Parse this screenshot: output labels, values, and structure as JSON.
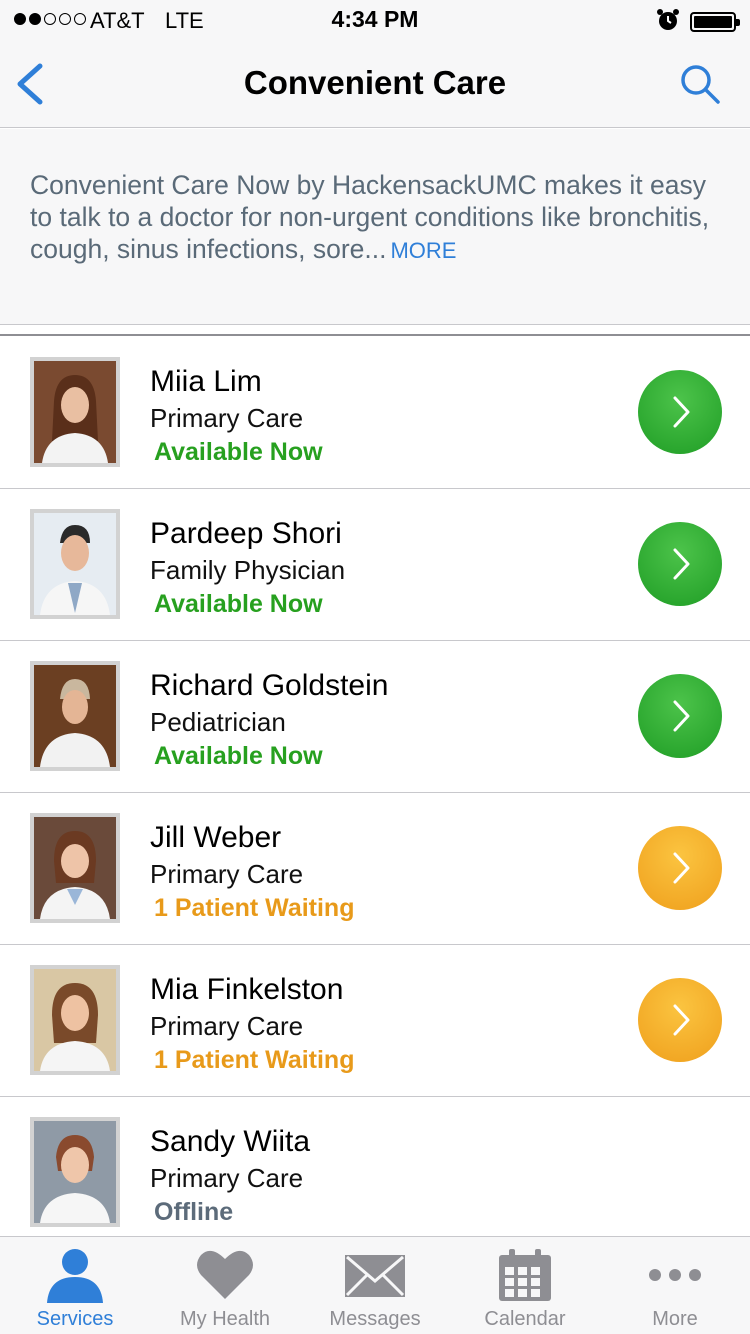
{
  "status_bar": {
    "carrier": "AT&T",
    "network": "LTE",
    "time": "4:34 PM"
  },
  "nav": {
    "title": "Convenient Care"
  },
  "description": {
    "text": "Convenient Care Now by HackensackUMC makes it easy to talk to a doctor for non-urgent conditions like bronchitis, cough, sinus infections, sore...",
    "more_label": "MORE"
  },
  "colors": {
    "accent": "#2f7fd8",
    "available": "#27a01f",
    "waiting": "#e89a1a",
    "offline": "#5c6b7a"
  },
  "doctors": [
    {
      "name": "Miia Lim",
      "specialty": "Primary Care",
      "status": "Available Now",
      "state": "available"
    },
    {
      "name": "Pardeep Shori",
      "specialty": "Family Physician",
      "status": "Available Now",
      "state": "available"
    },
    {
      "name": "Richard Goldstein",
      "specialty": "Pediatrician",
      "status": "Available Now",
      "state": "available"
    },
    {
      "name": "Jill Weber",
      "specialty": "Primary Care",
      "status": "1 Patient Waiting",
      "state": "waiting"
    },
    {
      "name": "Mia Finkelston",
      "specialty": "Primary Care",
      "status": "1 Patient Waiting",
      "state": "waiting"
    },
    {
      "name": "Sandy Wiita",
      "specialty": "Primary Care",
      "status": "Offline",
      "state": "offline"
    }
  ],
  "tabs": [
    {
      "label": "Services",
      "icon": "person-icon",
      "active": true
    },
    {
      "label": "My Health",
      "icon": "heart-icon",
      "active": false
    },
    {
      "label": "Messages",
      "icon": "envelope-icon",
      "active": false
    },
    {
      "label": "Calendar",
      "icon": "calendar-icon",
      "active": false
    },
    {
      "label": "More",
      "icon": "more-icon",
      "active": false
    }
  ]
}
